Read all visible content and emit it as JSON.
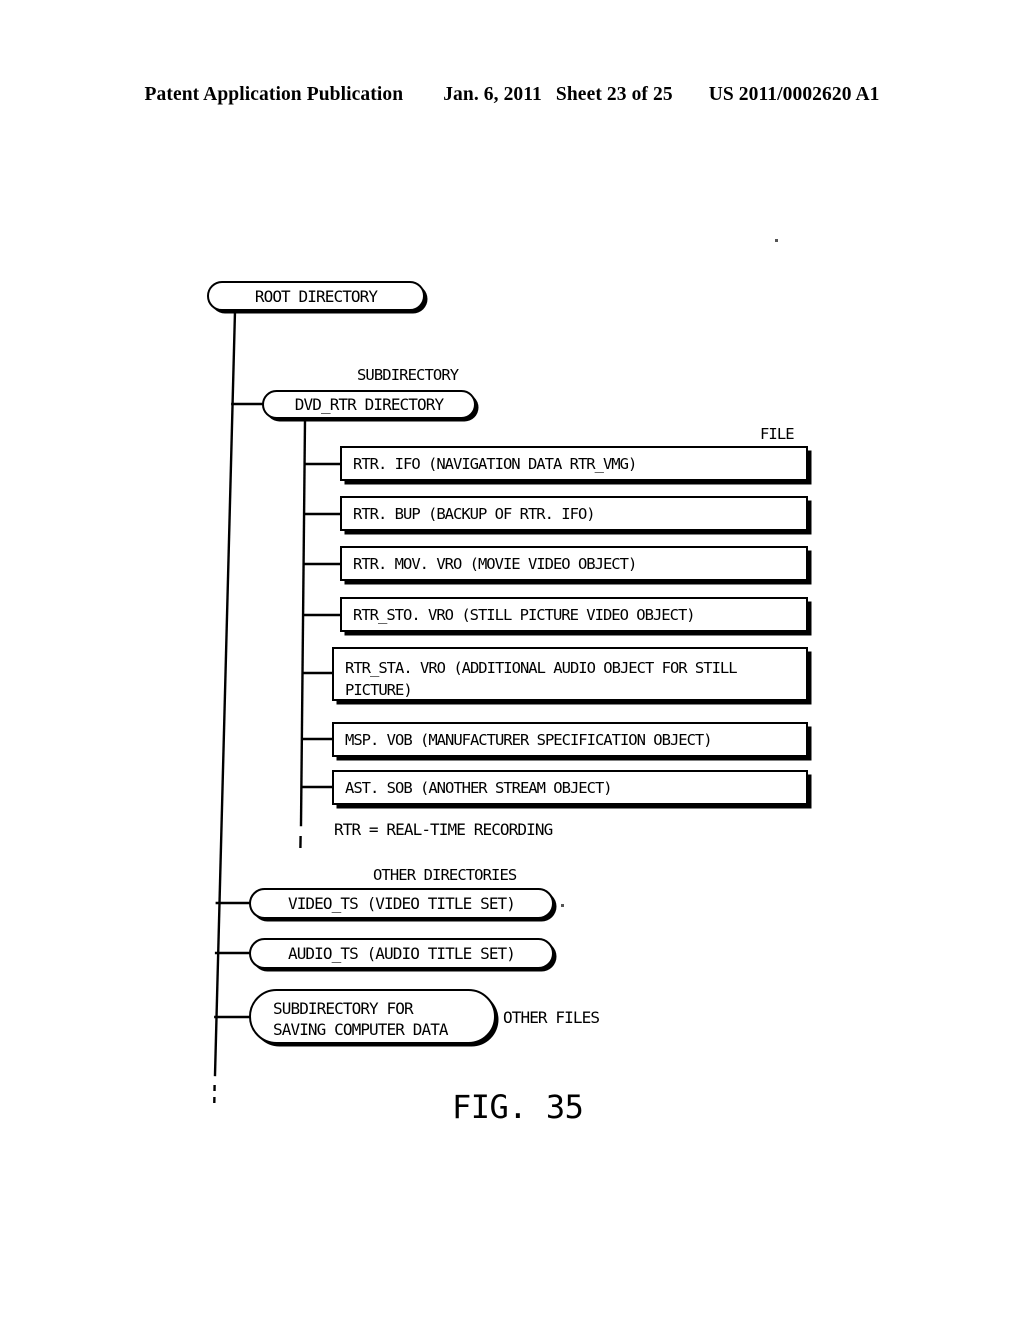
{
  "header": {
    "publication": "Patent Application Publication",
    "date": "Jan. 6, 2011",
    "sheet": "Sheet 23 of 25",
    "number": "US 2011/0002620 A1"
  },
  "figure": {
    "caption": "FIG. 35",
    "root": {
      "label": "ROOT DIRECTORY"
    },
    "subdirectory_label": "SUBDIRECTORY",
    "dvd_rtr": {
      "label": "DVD_RTR DIRECTORY"
    },
    "file_label": "FILE",
    "files": [
      {
        "label": "RTR. IFO  (NAVIGATION DATA RTR_VMG)"
      },
      {
        "label": "RTR. BUP  (BACKUP OF RTR. IFO)"
      },
      {
        "label": "RTR. MOV. VRO  (MOVIE VIDEO OBJECT)"
      },
      {
        "label": "RTR_STO. VRO  (STILL PICTURE VIDEO OBJECT)"
      },
      {
        "line1": "RTR_STA. VRO  (ADDITIONAL AUDIO OBJECT FOR STILL",
        "line2": "PICTURE)"
      },
      {
        "label": "MSP. VOB  (MANUFACTURER SPECIFICATION OBJECT)"
      },
      {
        "label": "AST. SOB  (ANOTHER STREAM OBJECT)"
      }
    ],
    "rtr_note": "RTR = REAL-TIME RECORDING",
    "other_directories_label": "OTHER DIRECTORIES",
    "other_dirs": [
      {
        "label": "VIDEO_TS (VIDEO TITLE SET)"
      },
      {
        "label": "AUDIO_TS (AUDIO TITLE SET)"
      }
    ],
    "computer_data_dir": {
      "line1": "SUBDIRECTORY FOR",
      "line2": "SAVING COMPUTER DATA"
    },
    "other_files_label": "OTHER FILES"
  },
  "colors": {
    "ink": "#000000",
    "paper": "#ffffff"
  }
}
